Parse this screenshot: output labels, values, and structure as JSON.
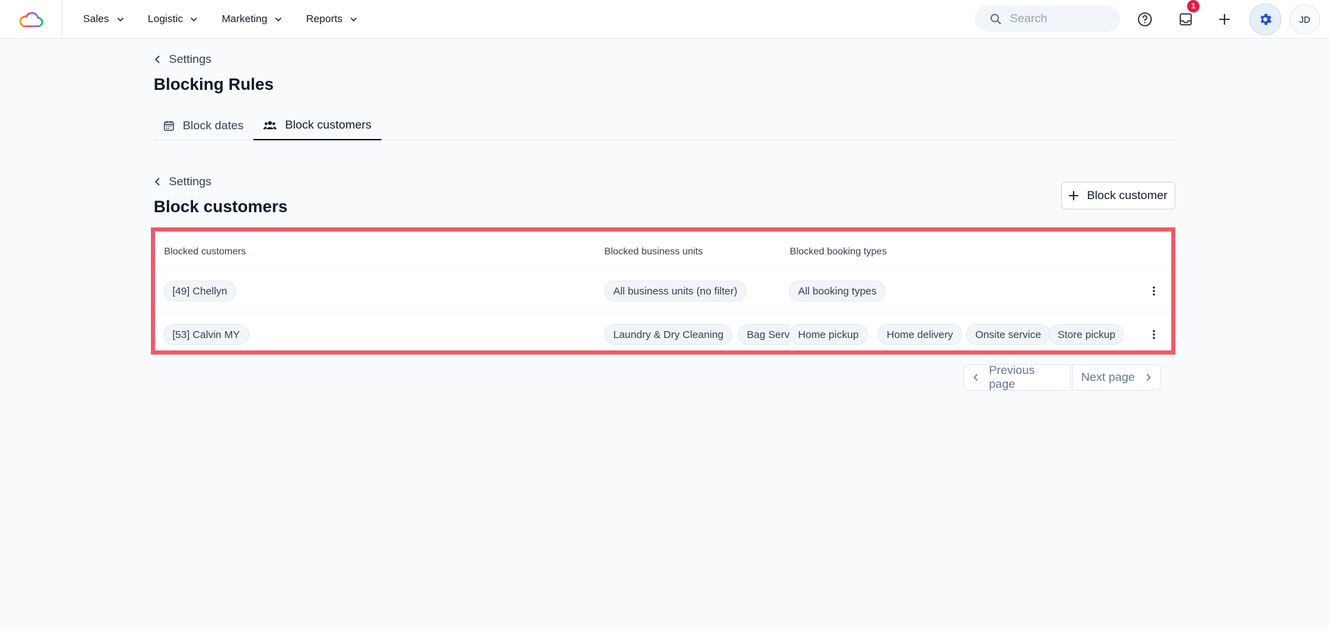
{
  "nav": {
    "items": [
      {
        "label": "Sales"
      },
      {
        "label": "Logistic"
      },
      {
        "label": "Marketing"
      },
      {
        "label": "Reports"
      }
    ],
    "search_placeholder": "Search",
    "inbox_badge": "1",
    "avatar_initials": "JD"
  },
  "header": {
    "back_label": "Settings",
    "title": "Blocking Rules"
  },
  "tabs": [
    {
      "label": "Block dates",
      "icon": "calendar-icon",
      "active": false
    },
    {
      "label": "Block customers",
      "icon": "users-icon",
      "active": true
    }
  ],
  "section": {
    "back_label": "Settings",
    "title": "Block customers",
    "add_button_label": "Block customer"
  },
  "table": {
    "columns": [
      "Blocked customers",
      "Blocked business units",
      "Blocked booking types"
    ],
    "rows": [
      {
        "customer": "[49] Chellyn",
        "business_units": [
          "All business units (no filter)"
        ],
        "booking_types": [
          "All booking types"
        ]
      },
      {
        "customer": "[53] Calvin MY",
        "business_units": [
          "Laundry & Dry Cleaning",
          "Bag Servi"
        ],
        "booking_types": [
          "Home pickup",
          "Home delivery",
          "Onsite service",
          "Store pickup"
        ]
      }
    ]
  },
  "pagination": {
    "prev_label": "Previous page",
    "next_label": "Next page"
  },
  "colors": {
    "highlight": "#ef5b68",
    "badge": "#e11d48",
    "accent": "#1d4ed8"
  }
}
